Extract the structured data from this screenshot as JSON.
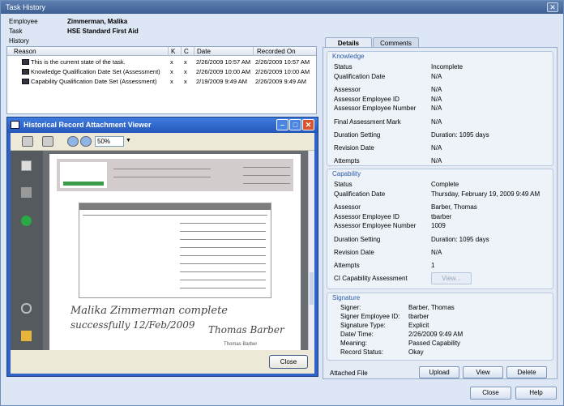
{
  "window": {
    "title": "Task History"
  },
  "header": {
    "employee_label": "Employee",
    "employee_value": "Zimmerman, Malika",
    "task_label": "Task",
    "task_value": "HSE  Standard First Aid",
    "history_label": "History"
  },
  "history": {
    "columns": [
      "Reason",
      "K",
      "C",
      "Date",
      "Recorded On"
    ],
    "rows": [
      {
        "reason": "This is the current state of the task.",
        "k": "x",
        "c": "x",
        "date": "2/26/2009 10:57 AM",
        "recorded": "2/26/2009 10:57 AM"
      },
      {
        "reason": "Knowledge Qualification Date Set (Assessment)",
        "k": "x",
        "c": "x",
        "date": "2/26/2009 10:00 AM",
        "recorded": "2/26/2009 10:00 AM"
      },
      {
        "reason": "Capability Qualification Date Set (Assessment)",
        "k": "x",
        "c": "x",
        "date": "2/19/2009 9:49 AM",
        "recorded": "2/26/2009 9:49 AM"
      }
    ]
  },
  "viewer": {
    "title": "Historical Record Attachment Viewer",
    "zoom": "50%",
    "close_label": "Close",
    "doc": {
      "sig_line1": "Malika Zimmerman complete",
      "sig_line2": "successfully 12/Feb/2009",
      "signer_script": "Thomas Barber",
      "signer_print": "Thomas Barber"
    }
  },
  "tabs": {
    "details": "Details",
    "comments": "Comments"
  },
  "knowledge": {
    "title": "Knowledge",
    "fields": [
      {
        "label": "Status",
        "value": "Incomplete"
      },
      {
        "label": "Qualification Date",
        "value": "N/A"
      },
      {
        "label": "Assessor",
        "value": "N/A"
      },
      {
        "label": "Assessor Employee ID",
        "value": "N/A"
      },
      {
        "label": "Assessor Employee Number",
        "value": "N/A"
      },
      {
        "label": "Final Assessment Mark",
        "value": "N/A"
      },
      {
        "label": "Duration Setting",
        "value": "Duration: 1095 days"
      },
      {
        "label": "Revision Date",
        "value": "N/A"
      },
      {
        "label": "Attempts",
        "value": "N/A"
      }
    ]
  },
  "capability": {
    "title": "Capability",
    "fields": [
      {
        "label": "Status",
        "value": "Complete"
      },
      {
        "label": "Qualification Date",
        "value": "Thursday, February 19, 2009 9:49 AM"
      },
      {
        "label": "Assessor",
        "value": "Barber, Thomas"
      },
      {
        "label": "Assessor Employee ID",
        "value": "tbarber"
      },
      {
        "label": "Assessor Employee Number",
        "value": "1009"
      },
      {
        "label": "Duration Setting",
        "value": "Duration: 1095 days"
      },
      {
        "label": "Revision Date",
        "value": "N/A"
      },
      {
        "label": "Attempts",
        "value": "1"
      },
      {
        "label": "CI Capability Assessment",
        "value": ""
      }
    ],
    "view_button": "View..."
  },
  "signature": {
    "title": "Signature",
    "fields": [
      {
        "label": "Signer:",
        "value": "Barber, Thomas"
      },
      {
        "label": "Signer Employee ID:",
        "value": "tbarber"
      },
      {
        "label": "Signature Type:",
        "value": "Explicit"
      },
      {
        "label": "Date/ Time:",
        "value": "2/26/2009 9:49 AM"
      },
      {
        "label": "Meaning:",
        "value": "Passed Capability"
      },
      {
        "label": "Record Status:",
        "value": "Okay"
      }
    ]
  },
  "attached": {
    "label": "Attached File",
    "upload": "Upload",
    "view": "View",
    "delete": "Delete"
  },
  "footer": {
    "close": "Close",
    "help": "Help"
  }
}
